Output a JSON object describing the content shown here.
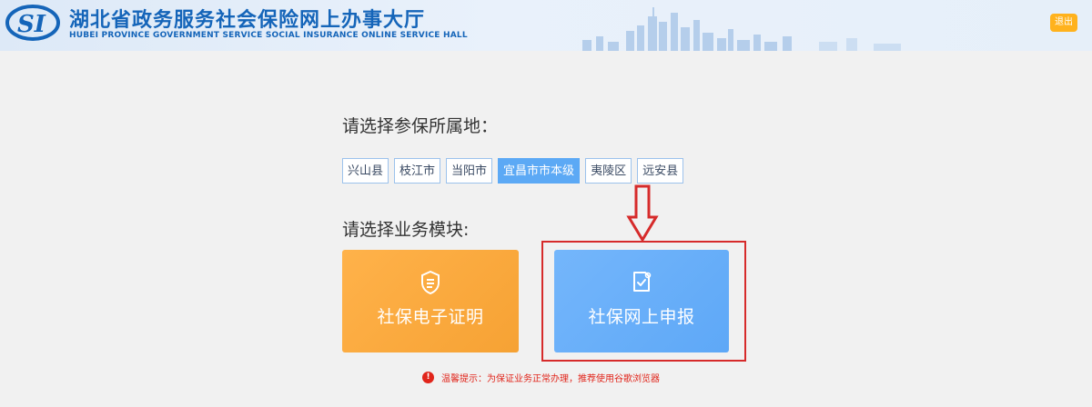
{
  "header": {
    "logo_text": "SI",
    "title": "湖北省政务服务社会保险网上办事大厅",
    "subtitle": "HUBEI PROVINCE GOVERNMENT SERVICE SOCIAL INSURANCE ONLINE SERVICE HALL",
    "logout_label": "退出"
  },
  "region_section": {
    "heading": "请选择参保所属地：",
    "items": [
      {
        "label": "兴山县"
      },
      {
        "label": "枝江市"
      },
      {
        "label": "当阳市"
      },
      {
        "label": "宜昌市市本级",
        "selected": true
      },
      {
        "label": "夷陵区"
      },
      {
        "label": "远安县"
      }
    ]
  },
  "module_section": {
    "heading": "请选择业务模块:",
    "cards": [
      {
        "label": "社保电子证明",
        "icon": "certificate-shield-icon",
        "color": "#f7a53a"
      },
      {
        "label": "社保网上申报",
        "icon": "document-check-icon",
        "color": "#62abf8"
      }
    ]
  },
  "notice": {
    "icon": "alert-icon",
    "text": "温馨提示：为保证业务正常办理，推荐使用谷歌浏览器"
  },
  "colors": {
    "brand_blue": "#1565b9",
    "accent_orange": "#ffb21d",
    "selected_blue": "#5ca9f5",
    "annotation_red": "#d62b2b",
    "notice_red": "#e1251b"
  }
}
